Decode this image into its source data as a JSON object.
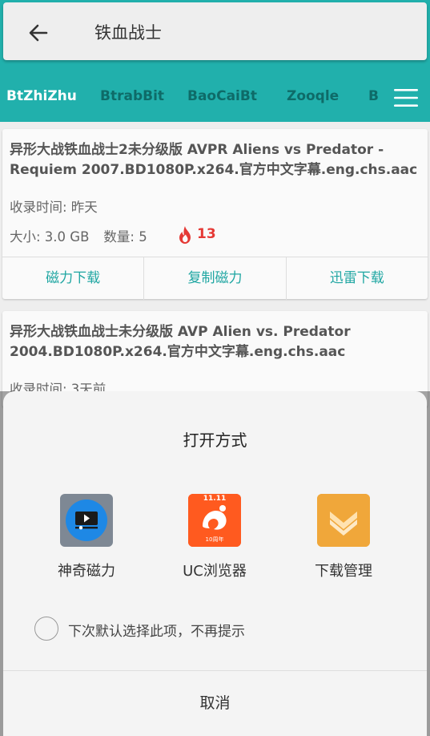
{
  "header": {
    "title": "铁血战士",
    "back_icon": "arrow-back-icon"
  },
  "tabs": [
    {
      "label": "BtZhiZhu",
      "active": true
    },
    {
      "label": "BtrabBit",
      "active": false
    },
    {
      "label": "BaoCaiBt",
      "active": false
    },
    {
      "label": "Zooqle",
      "active": false
    },
    {
      "label": "B",
      "active": false
    }
  ],
  "results": [
    {
      "title": "异形大战铁血战士2未分级版 AVPR Aliens vs Predator - Requiem 2007.BD1080P.x264.官方中文字幕.eng.chs.aac",
      "time": "收录时间: 昨天",
      "size": "大小: 3.0 GB",
      "count": "数量: 5",
      "hot": "13",
      "actions": [
        "磁力下载",
        "复制磁力",
        "迅雷下载"
      ]
    },
    {
      "title": "异形大战铁血战士未分级版 AVP Alien vs. Predator 2004.BD1080P.x264.官方中文字幕.eng.chs.aac",
      "time": "收录时间: 3天前"
    }
  ],
  "dialog": {
    "title": "打开方式",
    "apps": [
      {
        "label": "神奇磁力",
        "icon": "video-player-icon"
      },
      {
        "label": "UC浏览器",
        "icon": "uc-browser-icon",
        "badge": "11.11",
        "sub_badge": "10周年"
      },
      {
        "label": "下载管理",
        "icon": "download-manager-icon"
      }
    ],
    "remember_text": "下次默认选择此项，不再提示",
    "cancel": "取消"
  },
  "colors": {
    "teal": "#21b0ac",
    "action_text": "#1fa6a2",
    "hot_red": "#e53935"
  }
}
